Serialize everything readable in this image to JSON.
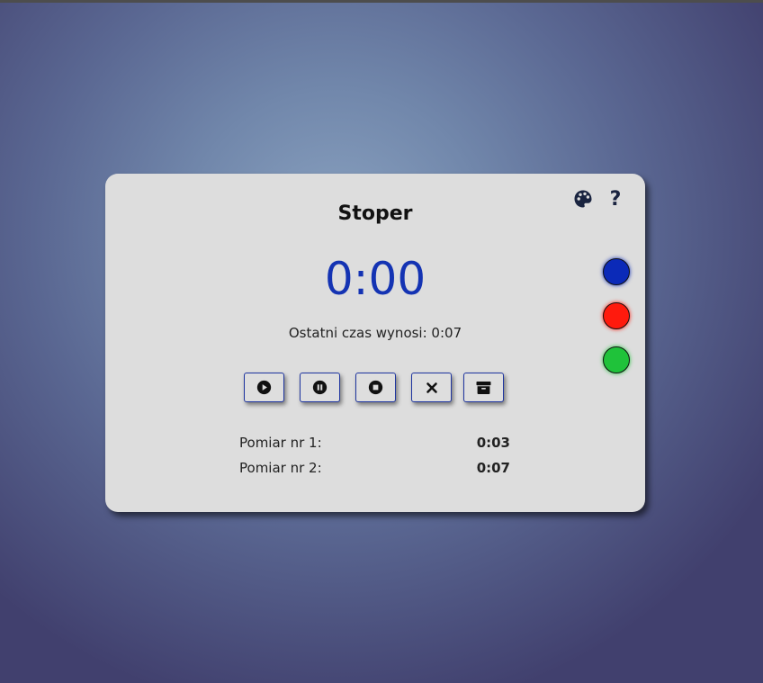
{
  "app": {
    "title": "Stoper",
    "timer_display": "0:00",
    "last_time_text": "Ostatni czas wynosi: 0:07"
  },
  "toolbar": {
    "start_icon": "play-icon",
    "pause_icon": "pause-icon",
    "stop_icon": "stop-icon",
    "reset_icon": "close-icon",
    "archive_icon": "archive-icon"
  },
  "top_icons": {
    "palette_icon": "palette-icon",
    "help_label": "?"
  },
  "colors": {
    "accent": "#1433b3",
    "swatches": [
      "#0b2ab8",
      "#ff1a0d",
      "#1fc23a"
    ]
  },
  "measurements": [
    {
      "label": "Pomiar nr 1:",
      "value": "0:03"
    },
    {
      "label": "Pomiar nr 2:",
      "value": "0:07"
    }
  ]
}
